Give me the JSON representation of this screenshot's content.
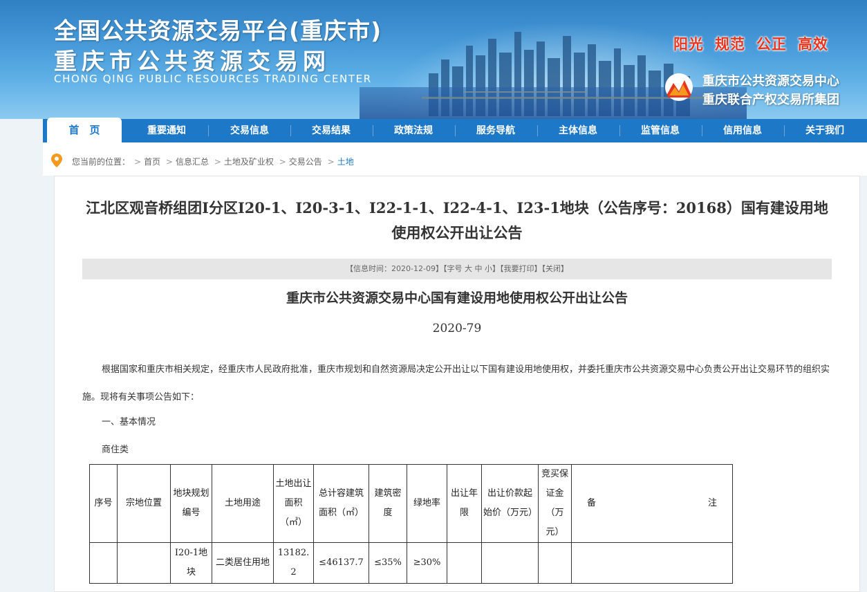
{
  "header": {
    "title_line1": "全国公共资源交易平台(重庆市)",
    "title_line2": "重庆市公共资源交易网",
    "title_en": "CHONG QING PUBLIC RESOURCES TRADING CENTER",
    "slogan": [
      "阳光",
      "规范",
      "公正",
      "高效"
    ],
    "org_line1": "重庆市公共资源交易中心",
    "org_line2": "重庆联合产权交易所集团",
    "slogan_color": "#e8361e"
  },
  "nav": {
    "items": [
      "首　页",
      "重要通知",
      "交易信息",
      "交易结果",
      "政策法规",
      "服务导航",
      "主体信息",
      "监管信息",
      "信用信息",
      "关于我们"
    ],
    "active_index": 0,
    "color": "#1d78c8"
  },
  "breadcrumb": {
    "prefix": "您当前的位置：",
    "items": [
      "首页",
      "信息汇总",
      "土地及矿业权",
      "交易公告",
      "土地"
    ],
    "separator": ">"
  },
  "article": {
    "title": "江北区观音桥组团I分区I20-1、I20-3-1、I22-1-1、I22-4-1、I23-1地块（公告序号：20168）国有建设用地使用权公开出让公告",
    "info": {
      "date_label": "【信息时间：2020-12-09】",
      "font_label": "【字号",
      "font_large": "大",
      "font_medium": "中",
      "font_small": "小】",
      "print_label": "【我要打印】",
      "close_label": "【关闭】"
    },
    "subtitle": "重庆市公共资源交易中心国有建设用地使用权公开出让公告",
    "doc_no": "2020-79",
    "paragraph": "根据国家和重庆市相关规定，经重庆市人民政府批准，重庆市规划和自然资源局决定公开出让以下国有建设用地使用权，并委托重庆市公共资源交易中心负责公开出让交易环节的组织实施。现将有关事项公告如下：",
    "section1": "一、基本情况",
    "section2": "商住类"
  },
  "table": {
    "headers": {
      "seq": "序号",
      "location": "宗地位置",
      "plot_code": "地块规划编号",
      "land_use": "土地用途",
      "area": "土地出让面积（㎡）",
      "gfa": "总计容建筑面积（㎡）",
      "density": "建筑密度",
      "green": "绿地率",
      "term": "出让年限",
      "price": "出让价款起始价（万元）",
      "deposit": "竞买保证金（万元）",
      "remark_a": "备",
      "remark_b": "注"
    },
    "rows": [
      {
        "seq": "",
        "location": "",
        "plot_code": "I20-1地块",
        "land_use": "二类居住用地",
        "area": "13182.2",
        "gfa": "≤46137.7",
        "density": "≤35%",
        "green": "≥30%",
        "term": "",
        "price": "",
        "deposit": "",
        "remark": ""
      }
    ]
  }
}
